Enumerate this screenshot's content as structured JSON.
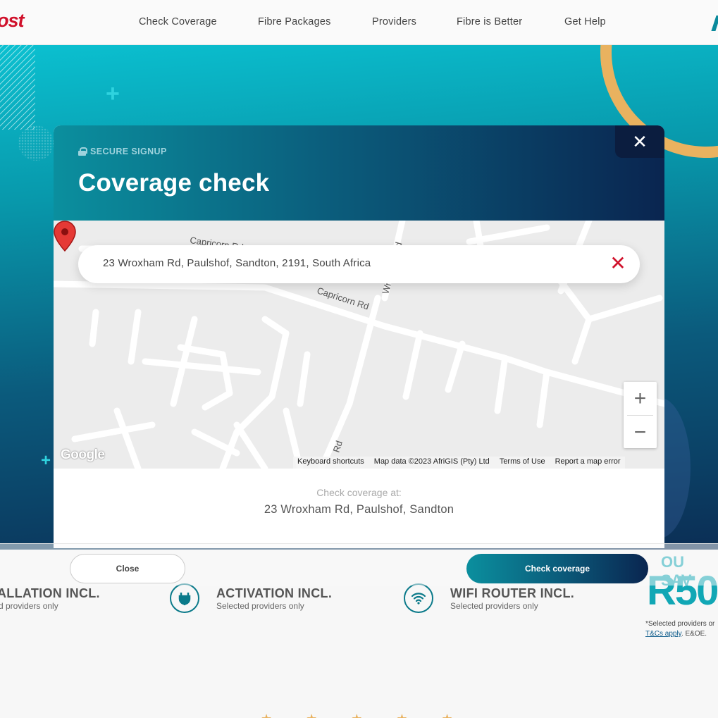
{
  "brand": {
    "logo_text": "ost",
    "accent": "#d0112b",
    "primary": "#0b8f9e",
    "dark": "#0a2550"
  },
  "nav": {
    "items": [
      {
        "label": "Check Coverage"
      },
      {
        "label": "Fibre Packages"
      },
      {
        "label": "Providers"
      },
      {
        "label": "Fibre is Better"
      },
      {
        "label": "Get Help"
      }
    ]
  },
  "modal": {
    "secure_label": "SECURE SIGNUP",
    "title": "Coverage check",
    "close_icon": "close-icon",
    "search": {
      "value": "23 Wroxham Rd, Paulshof, Sandton, 2191, South Africa",
      "clear_icon": "clear-icon"
    },
    "map": {
      "street_labels": [
        "Capricorn Rd",
        "Capricorn Rd",
        "Wroxham Rd",
        "Rd"
      ],
      "logo": "Google",
      "attribution": {
        "keyboard": "Keyboard shortcuts",
        "data": "Map data ©2023 AfriGIS (Pty) Ltd",
        "terms": "Terms of Use",
        "report": "Report a map error"
      },
      "zoom_in": "+",
      "zoom_out": "−"
    },
    "coverage_label": "Check coverage at:",
    "coverage_address": "23 Wroxham Rd, Paulshof, Sandton"
  },
  "footer": {
    "close_label": "Close",
    "check_label": "Check coverage"
  },
  "features": [
    {
      "title": "ALLATION INCL.",
      "sub": "d providers only"
    },
    {
      "title": "ACTIVATION INCL.",
      "sub": "Selected providers only",
      "icon": "plug-icon"
    },
    {
      "title": "WIFI ROUTER INCL.",
      "sub": "Selected providers only",
      "icon": "wifi-icon"
    }
  ],
  "savings": {
    "label": "OU SAV",
    "amount": "R50",
    "note": "*Selected providers or",
    "tc": "T&Cs apply",
    "tc_suffix": ". E&OE."
  }
}
